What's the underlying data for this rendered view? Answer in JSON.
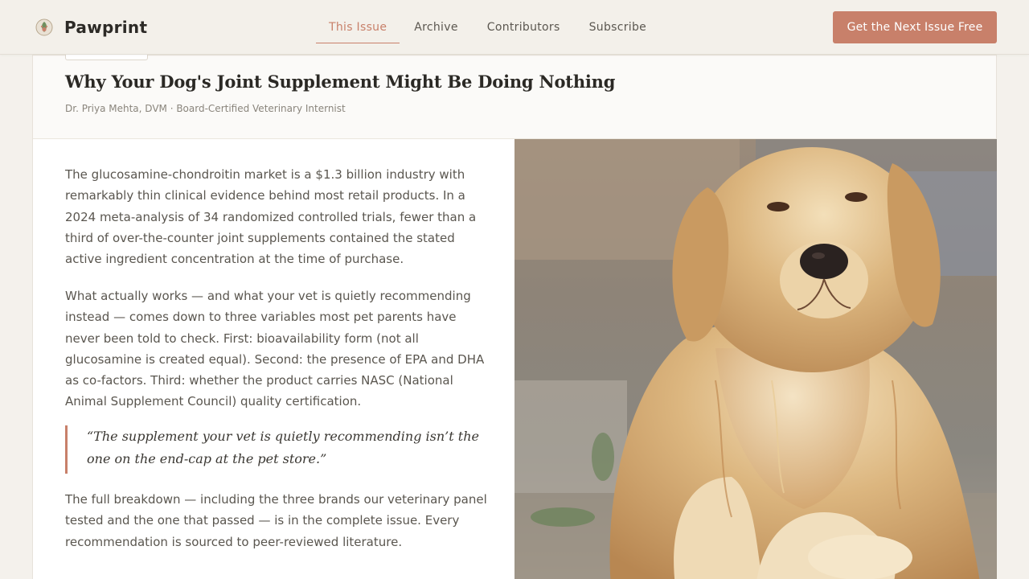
{
  "header": {
    "brand": "Pawprint",
    "nav": [
      "This Issue",
      "Archive",
      "Contributors",
      "Subscribe"
    ],
    "active_nav": "This Issue",
    "cta": "Get the Next Issue Free"
  },
  "article": {
    "title": "Why Your Dog's Joint Supplement Might Be Doing Nothing",
    "byline": "Dr. Priya Mehta, DVM · Board-Certified Veterinary Internist",
    "paragraph1": "The glucosamine-chondroitin market is a $1.3 billion industry with remarkably thin clinical evidence behind most retail products. In a 2024 meta-analysis of 34 randomized controlled trials, fewer than a third of over-the-counter joint supplements contained the stated active ingredient concentration at the time of purchase.",
    "paragraph2": "What actually works — and what your vet is quietly recommending instead — comes down to three variables most pet parents have never been told to check. First: bioavailability form (not all glucosamine is created equal). Second: the presence of EPA and DHA as co-factors. Third: whether the product carries NASC (National Animal Supplement Council) quality certification.",
    "pull_quote": "“The supplement your vet is quietly recommending isn’t the one on the end-cap at the pet store.”",
    "paragraph3": "The full breakdown — including the three brands our veterinary panel tested and the one that passed — is in the complete issue. Every recommendation is sourced to peer-reviewed literature."
  },
  "icons": {
    "logo": "paw-leaf-logo-icon"
  },
  "colors": {
    "accent": "#c8806a",
    "page_bg": "#f4f1ec",
    "text": "#5a564f"
  }
}
